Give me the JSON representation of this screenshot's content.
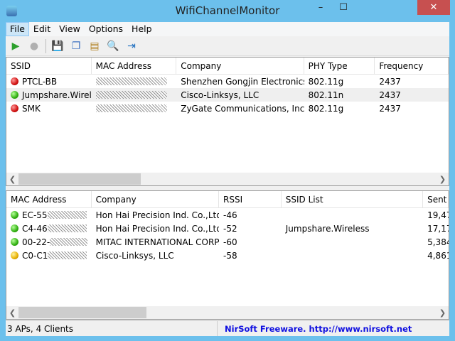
{
  "window": {
    "title": "WifiChannelMonitor",
    "minimize": "–",
    "maximize": "☐",
    "close": "✕"
  },
  "menu": [
    "File",
    "Edit",
    "View",
    "Options",
    "Help"
  ],
  "toolbar": [
    {
      "icon": "play-icon",
      "glyph": "▶",
      "color": "#2ca02c"
    },
    {
      "icon": "stop-icon",
      "glyph": "●",
      "color": "#b0b0b0"
    },
    {
      "icon": "save-icon",
      "glyph": "💾",
      "color": "#2a3f9a"
    },
    {
      "icon": "copy-icon",
      "glyph": "❐",
      "color": "#3a6fc0"
    },
    {
      "icon": "properties-icon",
      "glyph": "▤",
      "color": "#b08020"
    },
    {
      "icon": "find-icon",
      "glyph": "🔍",
      "color": "#3a6fc0"
    },
    {
      "icon": "exit-icon",
      "glyph": "⇥",
      "color": "#2070c0"
    }
  ],
  "aps": {
    "columns": [
      "SSID",
      "MAC Address",
      "Company",
      "PHY Type",
      "Frequency"
    ],
    "rows": [
      {
        "status": "red",
        "ssid": "PTCL-BB",
        "mac": "",
        "company": "Shenzhen Gongjin Electronics ...",
        "phy": "802.11g",
        "freq": "2437"
      },
      {
        "status": "green",
        "ssid": "Jumpshare.Wirel...",
        "mac": "",
        "company": "Cisco-Linksys, LLC",
        "phy": "802.11n",
        "freq": "2437"
      },
      {
        "status": "red",
        "ssid": "SMK",
        "mac": "",
        "company": "ZyGate Communications, Inc.",
        "phy": "802.11g",
        "freq": "2437"
      }
    ]
  },
  "clients": {
    "columns": [
      "MAC Address",
      "Company",
      "RSSI",
      "SSID List",
      "Sent"
    ],
    "rows": [
      {
        "status": "green",
        "mac": "EC-55",
        "company": "Hon Hai Precision Ind. Co.,Ltd.",
        "rssi": "-46",
        "ssids": "",
        "sent": "19,47"
      },
      {
        "status": "green",
        "mac": "C4-46",
        "company": "Hon Hai Precision Ind. Co.,Ltd.",
        "rssi": "-52",
        "ssids": "Jumpshare.Wireless",
        "sent": "17,17"
      },
      {
        "status": "green",
        "mac": "00-22-",
        "company": "MITAC INTERNATIONAL CORP.",
        "rssi": "-60",
        "ssids": "",
        "sent": "5,384"
      },
      {
        "status": "yellow",
        "mac": "C0-C1",
        "company": "Cisco-Linksys, LLC",
        "rssi": "-58",
        "ssids": "",
        "sent": "4,861"
      }
    ]
  },
  "status": {
    "summary": "3 APs, 4 Clients",
    "credit": "NirSoft Freeware.  http://www.nirsoft.net"
  }
}
